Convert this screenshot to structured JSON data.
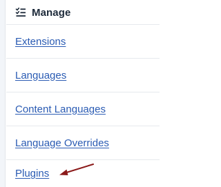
{
  "header": {
    "title": "Manage",
    "icon": "checklist-icon"
  },
  "menu": {
    "items": [
      {
        "label": "Extensions"
      },
      {
        "label": "Languages"
      },
      {
        "label": "Content Languages"
      },
      {
        "label": "Language Overrides"
      },
      {
        "label": "Plugins"
      }
    ]
  },
  "annotation": {
    "icon": "arrow-annotation",
    "color": "#8b1a1a"
  },
  "colors": {
    "link": "#2a5bb3",
    "heading": "#1d2a3a"
  }
}
